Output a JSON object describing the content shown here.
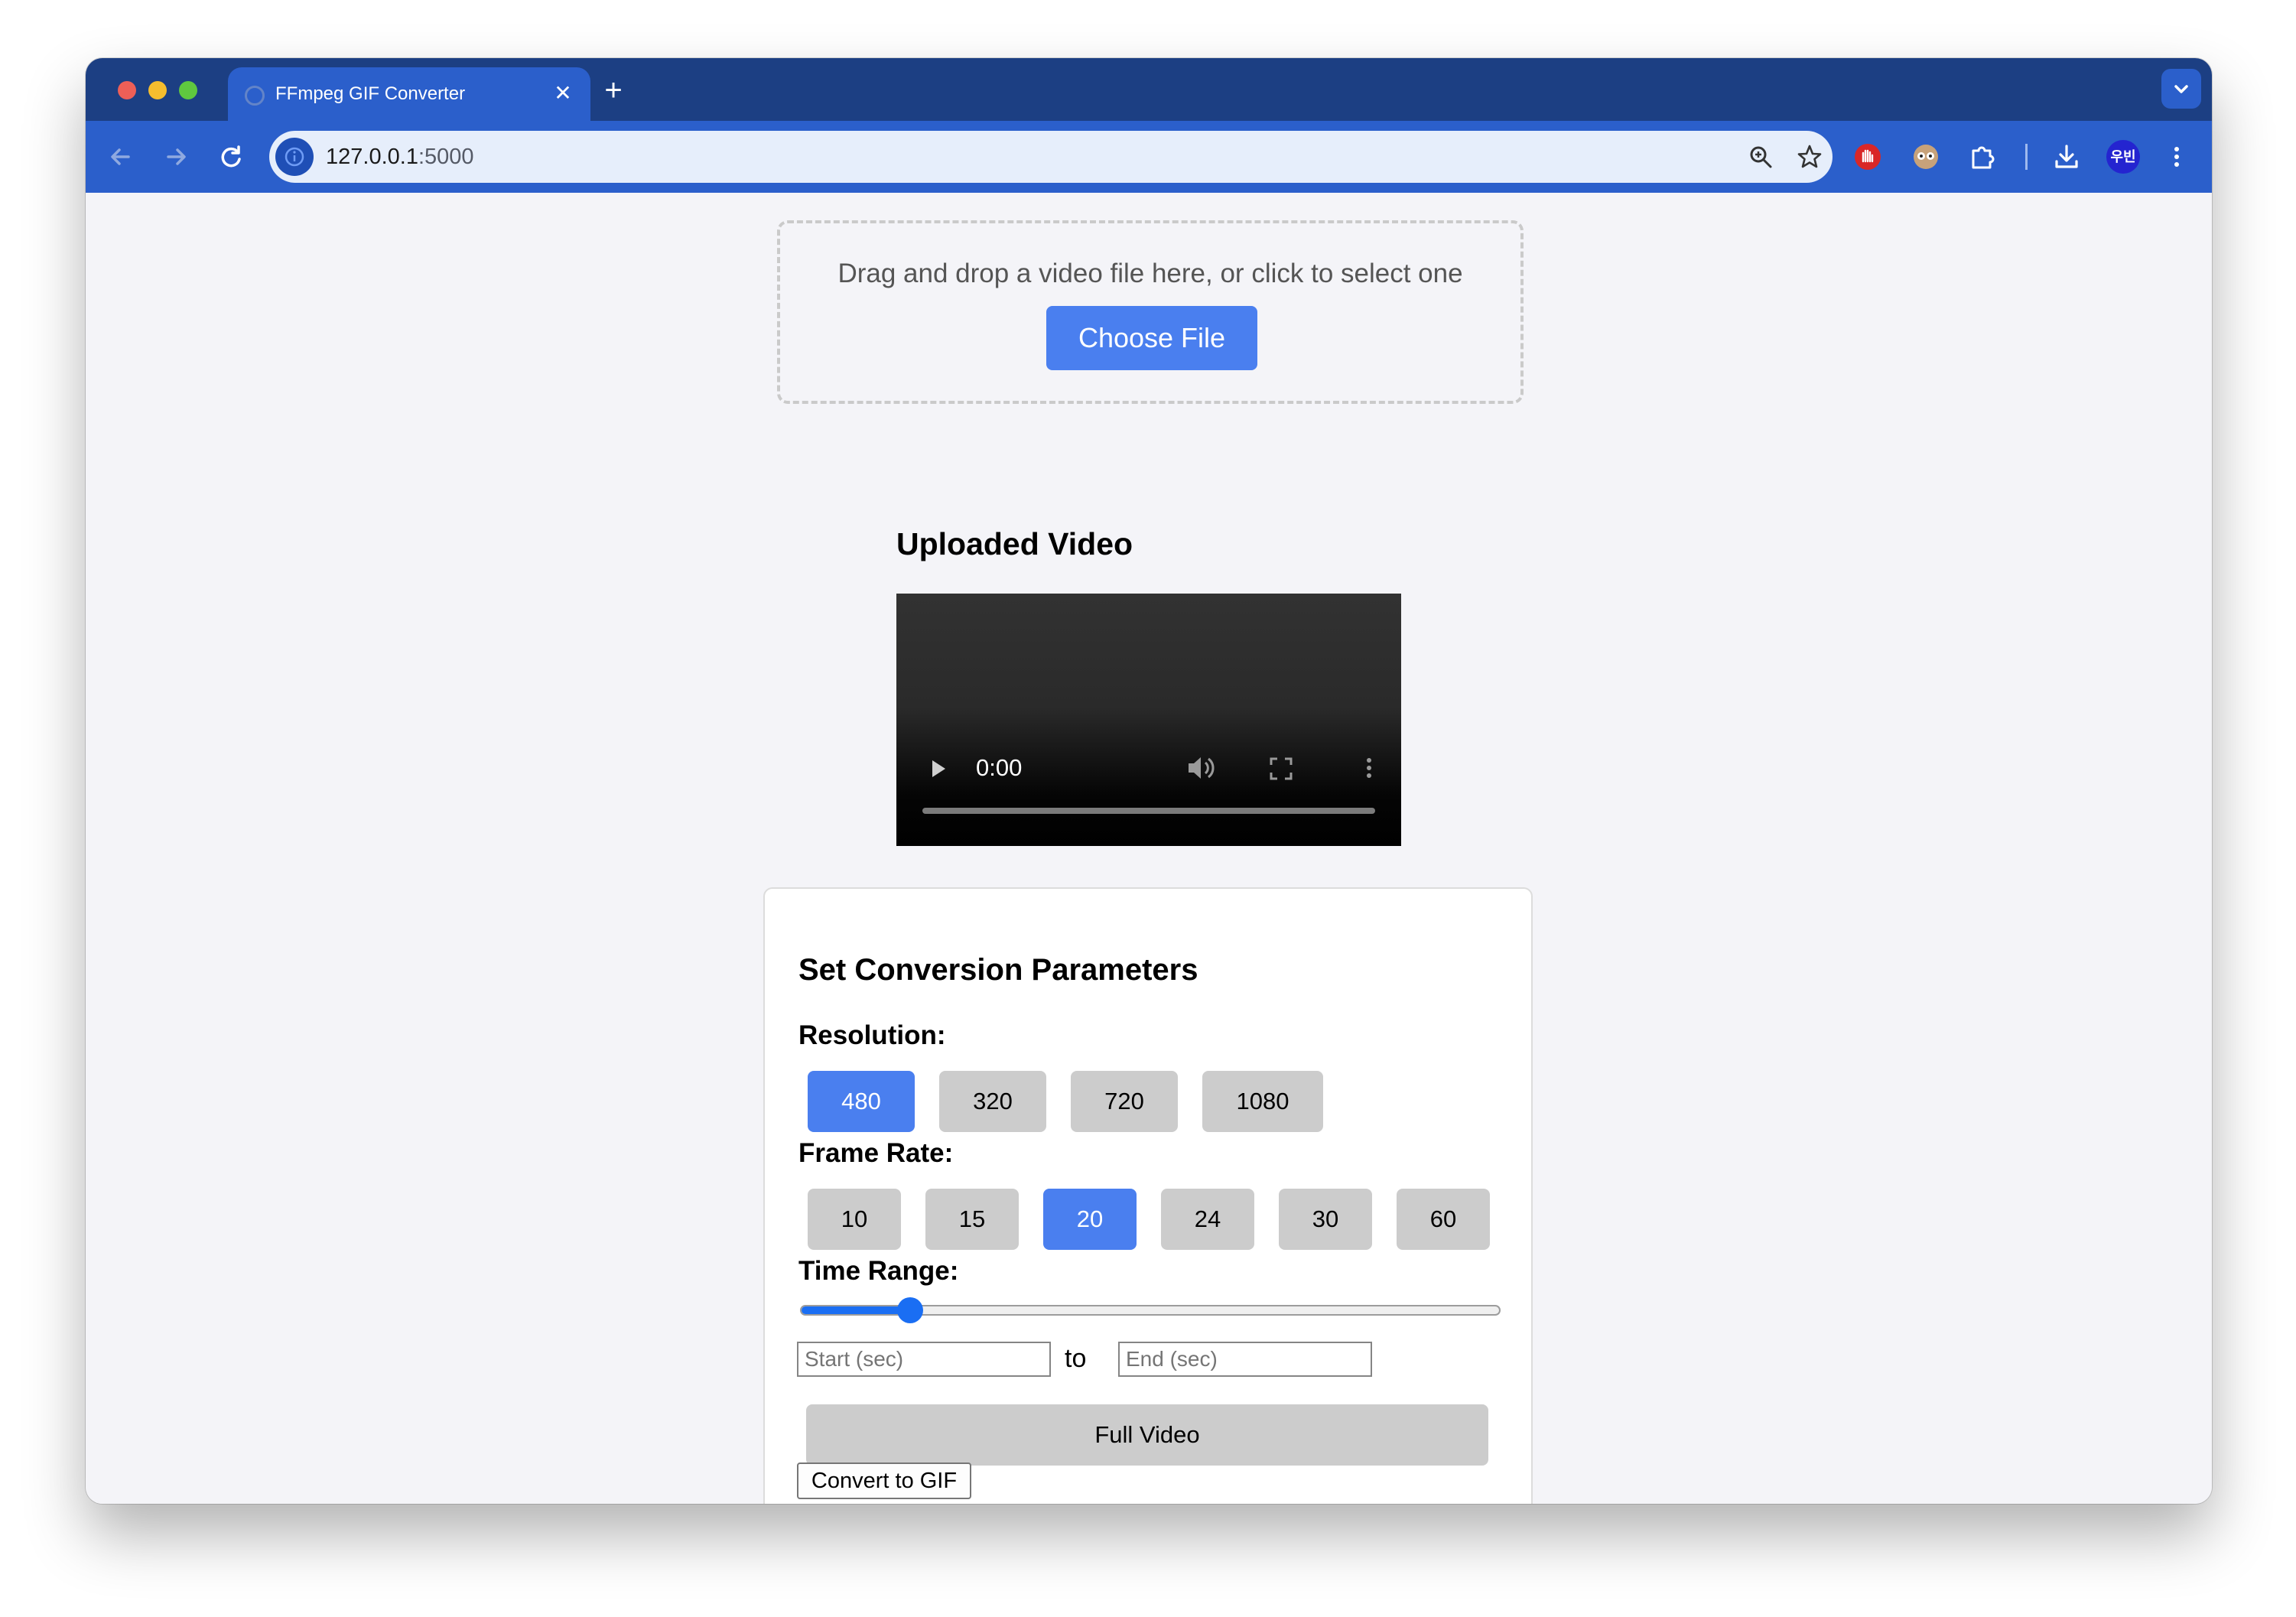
{
  "browser": {
    "tab_title": "FFmpeg GIF Converter",
    "tab_close_glyph": "✕",
    "new_tab_glyph": "+",
    "url_host": "127.0.0.1",
    "url_port": ":5000",
    "profile_label": "우빈",
    "colors": {
      "tabstrip": "#1c3f83",
      "toolbar": "#2b5fcb",
      "omnibox": "#e6eefb"
    }
  },
  "upload": {
    "prompt": "Drag and drop a video file here, or click to select one",
    "choose_button": "Choose File"
  },
  "video_section": {
    "title": "Uploaded Video",
    "current_time": "0:00",
    "progress": 0
  },
  "params": {
    "title": "Set Conversion Parameters",
    "resolution": {
      "label": "Resolution:",
      "options": [
        "480",
        "320",
        "720",
        "1080"
      ],
      "selected": "480"
    },
    "frame_rate": {
      "label": "Frame Rate:",
      "options": [
        "10",
        "15",
        "20",
        "24",
        "30",
        "60"
      ],
      "selected": "20"
    },
    "time_range": {
      "label": "Time Range:",
      "slider_fraction": 0.155,
      "start_placeholder": "Start (sec)",
      "to_label": "to",
      "end_placeholder": "End (sec)"
    },
    "full_video_button": "Full Video",
    "convert_button": "Convert to GIF",
    "colors": {
      "accent": "#4a7fef",
      "option_idle": "#cccccc"
    }
  }
}
